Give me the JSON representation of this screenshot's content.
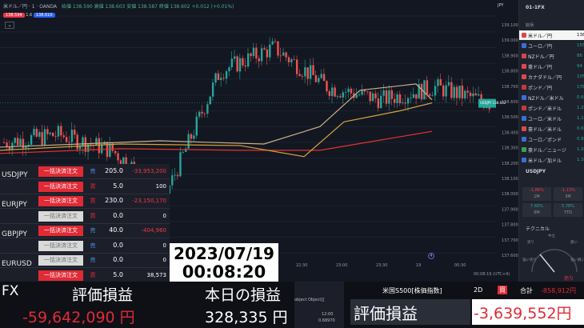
{
  "chart": {
    "symbol_title": "米ドル／円 · 1 · OANDA",
    "sell_price": "138.594",
    "spread": "1.6",
    "buy_price": "138.610",
    "ohlc": "始値 138.590  高値 138.603  安値 138.587  終値 138.602 +0.012 (+0.01%)",
    "current_tag": "USDJPY\n138.602\n00:41",
    "price_ticks": [
      "139.100",
      "139.000",
      "138.900",
      "138.800",
      "138.700",
      "138.600",
      "138.500",
      "138.400",
      "138.300",
      "138.200",
      "138.100",
      "138.000",
      "137.900",
      "137.800",
      "137.700",
      "137.600"
    ],
    "time_ticks": [
      "22:30",
      "23:00",
      "23:30",
      "19",
      "00:30"
    ],
    "status_right": "00:08:19 (UTC+9)"
  },
  "chart_data": {
    "type": "line",
    "title": "米ドル／円 · 1 · OANDA",
    "x": [
      "22:00",
      "22:15",
      "22:30",
      "22:45",
      "23:00",
      "23:15",
      "23:30",
      "23:45",
      "00:00",
      "00:08"
    ],
    "series": [
      {
        "name": "USDJPY",
        "values": [
          138.35,
          138.4,
          138.3,
          138.02,
          138.8,
          138.95,
          138.7,
          138.62,
          138.7,
          138.6
        ]
      }
    ],
    "ylim": [
      137.55,
      139.15
    ]
  },
  "watchlist": {
    "title": "01-1FX",
    "col": "銘柄",
    "items": [
      {
        "name": "米ドル／円",
        "val": "138",
        "color": "#e0474c",
        "selected": true
      },
      {
        "name": "ユーロ／円",
        "val": "155",
        "color": "#3a6fd8"
      },
      {
        "name": "NZドル／円",
        "val": "86",
        "color": "#d14848"
      },
      {
        "name": "豪ドル／円",
        "val": "94",
        "color": "#e0474c"
      },
      {
        "name": "カナダドル／円",
        "val": "105",
        "color": "#e0474c"
      },
      {
        "name": "ポンド／円",
        "val": "178",
        "color": "#c23b3b"
      },
      {
        "name": "NZドル／米ドル",
        "val": "0.62",
        "color": "#3a6fd8"
      },
      {
        "name": "ポンド／米ドル",
        "val": "1.28",
        "color": "#c23b3b"
      },
      {
        "name": "ユーロ／米ドル",
        "val": "1.12",
        "color": "#3a6fd8"
      },
      {
        "name": "豪ドル／米ドル",
        "val": "0.68",
        "color": "#e0474c"
      },
      {
        "name": "ユーロ／ポンド",
        "val": "0.87",
        "color": "#3a6fd8"
      },
      {
        "name": "豪ドル／ニュージ",
        "val": "1.09",
        "color": "#3aa05a"
      },
      {
        "name": "米ドル／加ドル",
        "val": "1.31",
        "color": "#3a6fd8"
      }
    ],
    "detail_symbol": "USDJPY",
    "changes": [
      "-1.86%",
      "-1.13%",
      "7.60%",
      "5.78%"
    ],
    "change_labels": [
      "1M",
      "3M",
      "6M",
      "YTD"
    ],
    "technical": "テクニカル",
    "gauge_labels": [
      "売り",
      "中立",
      "買い",
      "強い売り",
      "強い買い"
    ],
    "gauge_result": "売り"
  },
  "orders": {
    "rows": [
      {
        "pair": "USDJPY",
        "btn": "一括決済注文",
        "active": true,
        "side": "売",
        "qty": "205.0",
        "pl": "-33,953,200",
        "plcolor": "#f23645"
      },
      {
        "pair": "",
        "btn": "一括決済注文",
        "active": true,
        "side": "買",
        "qty": "5.0",
        "pl": "100",
        "plcolor": "#ffffff"
      },
      {
        "pair": "EURJPY",
        "btn": "一括決済注文",
        "active": true,
        "side": "買",
        "qty": "230.0",
        "pl": "-23,150,170",
        "plcolor": "#f23645"
      },
      {
        "pair": "",
        "btn": "一括決済注文",
        "active": false,
        "side": "買",
        "qty": "0.0",
        "pl": "0",
        "plcolor": "#ffffff"
      },
      {
        "pair": "GBPJPY",
        "btn": "一括決済注文",
        "active": true,
        "side": "売",
        "qty": "40.0",
        "pl": "-404,960",
        "plcolor": "#f23645"
      },
      {
        "pair": "",
        "btn": "一括決済注文",
        "active": false,
        "side": "売",
        "qty": "0.0",
        "pl": "0",
        "plcolor": "#ffffff"
      },
      {
        "pair": "EURUSD",
        "btn": "一括決済注文",
        "active": false,
        "side": "売",
        "qty": "0.0",
        "pl": "0",
        "plcolor": "#ffffff"
      },
      {
        "pair": "",
        "btn": "一括決済注文",
        "active": true,
        "side": "買",
        "qty": "5.0",
        "pl": "38,573",
        "plcolor": "#ffffff"
      }
    ]
  },
  "clock": {
    "date": "2023/07/19",
    "time": "00:08:20"
  },
  "bottom": {
    "fx_label": "FX",
    "pl_label": "評価損益",
    "pl_value": "-59,642,090 円",
    "today_label": "本日の損益",
    "today_value": "328,335 円",
    "sp500": "米国S500[株価指数]",
    "sp_period": "2D",
    "sp_side": "買",
    "sp_total_label": "合計",
    "sp_total": "-858,912円",
    "sp_pl_label": "評価損益",
    "sp_pl_value": "-3,639,552円",
    "mini_time": "12:00",
    "mini_price": "0.68970",
    "object_text": "object Object]]"
  }
}
